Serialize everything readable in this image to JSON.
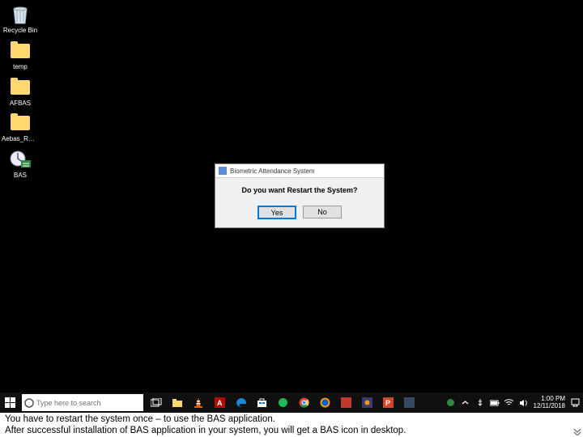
{
  "desktop_icons": {
    "recycle": "Recycle Bin",
    "temp": "temp",
    "afbas": "AFBAS",
    "aebas": "Aebas_RD_...",
    "bas": "BAS"
  },
  "dialog": {
    "title": "Biometric Attendance System",
    "message": "Do you want Restart the System?",
    "yes": "Yes",
    "no": "No"
  },
  "taskbar": {
    "search_placeholder": "Type here to search"
  },
  "tray": {
    "time": "1:00 PM",
    "date": "12/11/2018"
  },
  "caption": {
    "line1": "You have to restart the system once – to use the BAS application.",
    "line2": "After successful installation of BAS application in your system, you will get a BAS icon in desktop."
  }
}
